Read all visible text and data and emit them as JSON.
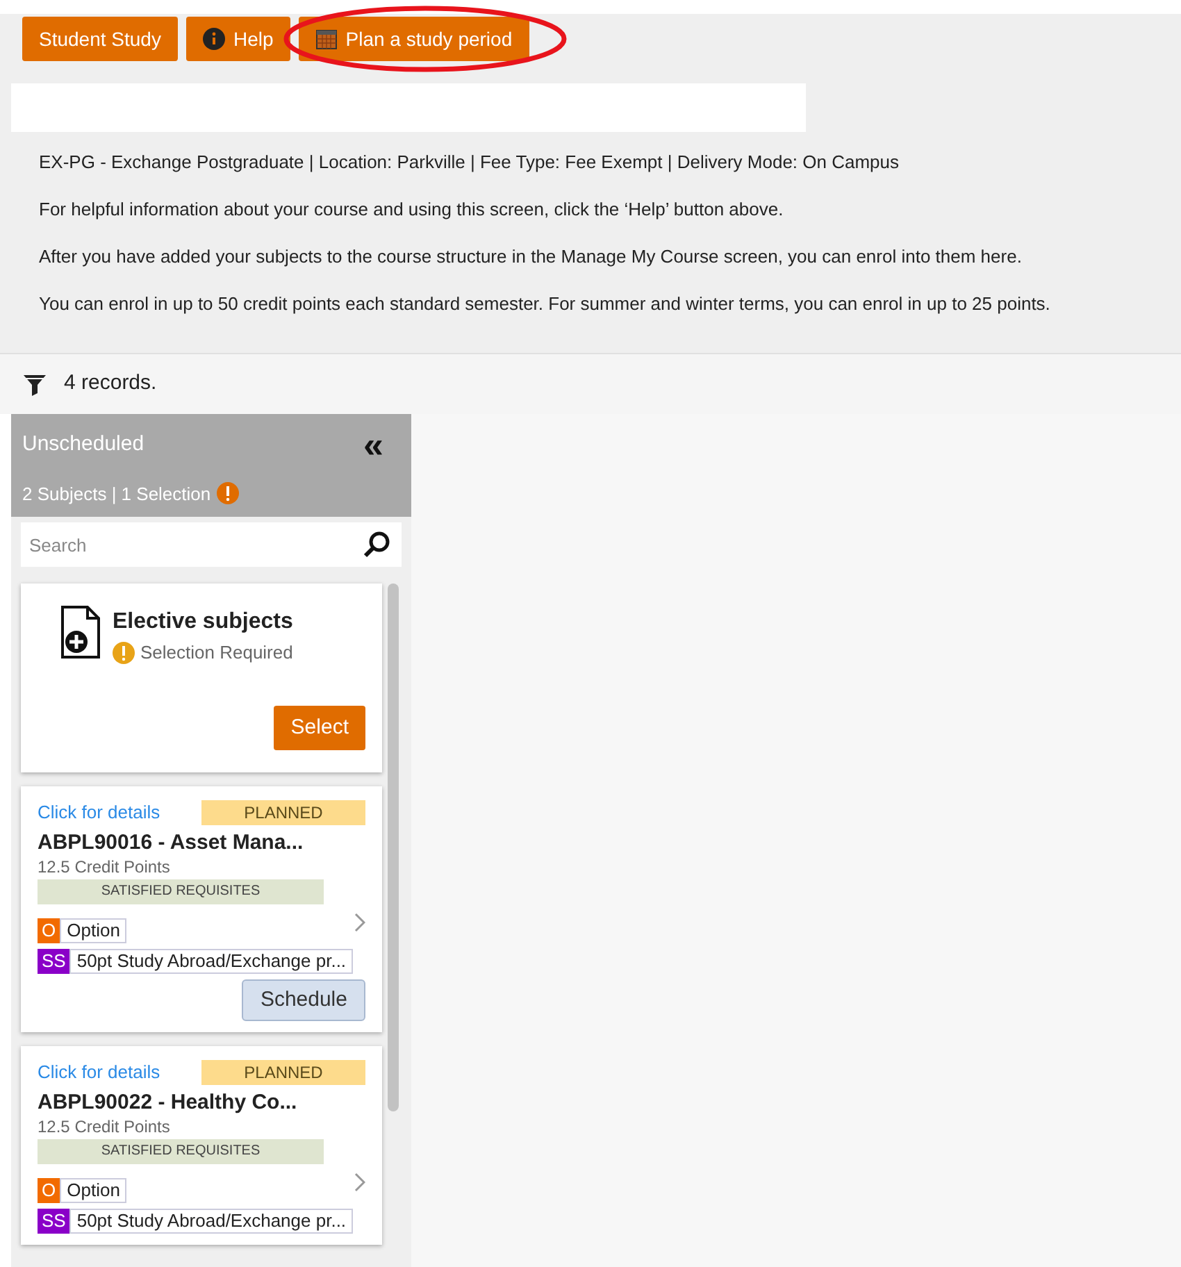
{
  "toolbar": {
    "buttons": [
      {
        "label": "Student Study",
        "kind": "plain"
      },
      {
        "label": "Help",
        "kind": "info"
      },
      {
        "label": "Plan a study period",
        "kind": "calendar",
        "circled": true
      }
    ]
  },
  "info_lines": [
    "EX-PG - Exchange Postgraduate | Location: Parkville | Fee Type: Fee Exempt | Delivery Mode: On Campus",
    "For helpful information about your course and using this screen, click the ‘Help’ button above.",
    "After you have added your subjects to the course structure in the Manage My Course screen, you can enrol into them here.",
    "You can enrol in up to 50 credit points each standard semester. For summer and winter terms, you can enrol in up to 25 points."
  ],
  "records": "4 records.",
  "panel": {
    "title": "Unscheduled",
    "collapse": "«",
    "summary": "2 Subjects | 1 Selection",
    "search": {
      "placeholder": "Search"
    },
    "cards": [
      {
        "kind": "elective",
        "title": "Elective subjects",
        "status": "Selection Required",
        "button": "Select"
      },
      {
        "kind": "subject",
        "link": "Click for details",
        "badge": "PLANNED",
        "title": "ABPL90016 - Asset Mana...",
        "credits": "12.5 Credit Points",
        "requisites": "SATISFIED REQUISITES",
        "tags": [
          {
            "code": "O",
            "label": "Option",
            "color": "#f26b00"
          },
          {
            "code": "SS",
            "label": "50pt Study Abroad/Exchange pr...",
            "color": "#8a00c8"
          }
        ],
        "button": "Schedule"
      },
      {
        "kind": "subject",
        "link": "Click for details",
        "badge": "PLANNED",
        "title": "ABPL90022 - Healthy Co...",
        "credits": "12.5 Credit Points",
        "requisites": "SATISFIED REQUISITES",
        "tags": [
          {
            "code": "O",
            "label": "Option",
            "color": "#f26b00"
          },
          {
            "code": "SS",
            "label": "50pt Study Abroad/Exchange pr...",
            "color": "#8a00c8"
          }
        ]
      }
    ]
  }
}
